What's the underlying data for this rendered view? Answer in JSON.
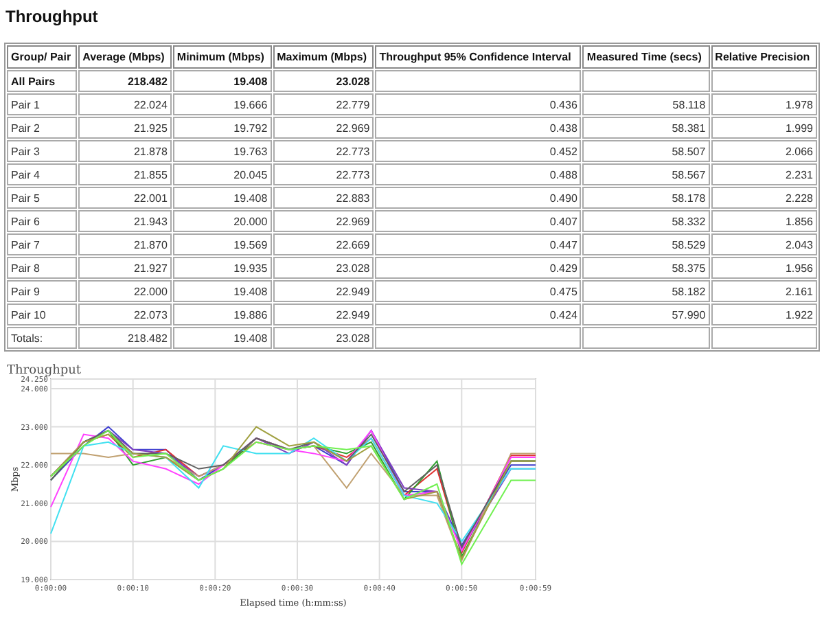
{
  "title": "Throughput",
  "table": {
    "columns": [
      "Group/ Pair",
      "Average (Mbps)",
      "Minimum (Mbps)",
      "Maximum (Mbps)",
      "Throughput 95% Confidence Interval",
      "Measured Time (secs)",
      "Relative Precision"
    ],
    "rows": [
      {
        "kind": "group",
        "cells": [
          "All Pairs",
          "218.482",
          "19.408",
          "23.028"
        ]
      },
      {
        "kind": "pair",
        "cells": [
          "Pair 1",
          "22.024",
          "19.666",
          "22.779",
          "0.436",
          "58.118",
          "1.978"
        ]
      },
      {
        "kind": "pair",
        "cells": [
          "Pair 2",
          "21.925",
          "19.792",
          "22.969",
          "0.438",
          "58.381",
          "1.999"
        ]
      },
      {
        "kind": "pair",
        "cells": [
          "Pair 3",
          "21.878",
          "19.763",
          "22.773",
          "0.452",
          "58.507",
          "2.066"
        ]
      },
      {
        "kind": "pair",
        "cells": [
          "Pair 4",
          "21.855",
          "20.045",
          "22.773",
          "0.488",
          "58.567",
          "2.231"
        ]
      },
      {
        "kind": "pair",
        "cells": [
          "Pair 5",
          "22.001",
          "19.408",
          "22.883",
          "0.490",
          "58.178",
          "2.228"
        ]
      },
      {
        "kind": "pair",
        "cells": [
          "Pair 6",
          "21.943",
          "20.000",
          "22.969",
          "0.407",
          "58.332",
          "1.856"
        ]
      },
      {
        "kind": "pair",
        "cells": [
          "Pair 7",
          "21.870",
          "19.569",
          "22.669",
          "0.447",
          "58.529",
          "2.043"
        ]
      },
      {
        "kind": "pair",
        "cells": [
          "Pair 8",
          "21.927",
          "19.935",
          "23.028",
          "0.429",
          "58.375",
          "1.956"
        ]
      },
      {
        "kind": "pair",
        "cells": [
          "Pair 9",
          "22.000",
          "19.408",
          "22.949",
          "0.475",
          "58.182",
          "2.161"
        ]
      },
      {
        "kind": "pair",
        "cells": [
          "Pair 10",
          "22.073",
          "19.886",
          "22.949",
          "0.424",
          "57.990",
          "1.922"
        ]
      },
      {
        "kind": "total",
        "cells": [
          "Totals:",
          "218.482",
          "19.408",
          "23.028"
        ]
      }
    ]
  },
  "chart": {
    "chart_data": {
      "type": "line",
      "grid": true,
      "title": "Throughput",
      "xlabel": "Elapsed time (h:mm:ss)",
      "ylabel": "Mbps",
      "x": [
        0,
        4,
        7,
        10,
        14,
        18,
        21,
        25,
        29,
        32,
        36,
        39,
        43,
        47,
        50,
        56,
        59
      ],
      "series": [
        {
          "color": "#4040d0",
          "values": [
            21.6,
            22.5,
            23.0,
            22.4,
            22.4,
            21.6,
            22.0,
            22.7,
            22.4,
            22.5,
            22.0,
            22.9,
            21.3,
            21.3,
            19.9,
            22.0,
            22.0
          ]
        },
        {
          "color": "#e03030",
          "values": [
            21.7,
            22.6,
            22.8,
            22.2,
            22.4,
            21.7,
            22.0,
            22.6,
            22.4,
            22.5,
            22.2,
            22.7,
            21.2,
            21.9,
            19.7,
            22.25,
            22.25
          ]
        },
        {
          "color": "#30a030",
          "values": [
            21.6,
            22.6,
            22.9,
            22.0,
            22.2,
            21.6,
            21.9,
            22.7,
            22.4,
            22.5,
            22.3,
            22.6,
            21.1,
            22.1,
            19.6,
            22.1,
            22.1
          ]
        },
        {
          "color": "#8040c0",
          "values": [
            21.7,
            22.6,
            22.9,
            22.4,
            22.3,
            21.7,
            22.0,
            22.7,
            22.3,
            22.6,
            22.0,
            22.9,
            21.4,
            21.3,
            19.8,
            21.9,
            21.9
          ]
        },
        {
          "color": "#c0a070",
          "values": [
            22.3,
            22.3,
            22.2,
            22.3,
            22.2,
            21.7,
            22.0,
            22.7,
            22.4,
            22.5,
            21.4,
            22.3,
            21.2,
            21.2,
            19.5,
            22.3,
            22.3
          ]
        },
        {
          "color": "#ff40ff",
          "values": [
            20.9,
            22.8,
            22.7,
            22.1,
            21.9,
            21.5,
            22.0,
            22.7,
            22.4,
            22.3,
            22.1,
            22.9,
            21.2,
            21.3,
            19.75,
            22.2,
            22.2
          ]
        },
        {
          "color": "#40e0f0",
          "values": [
            20.2,
            22.5,
            22.6,
            22.3,
            22.2,
            21.4,
            22.5,
            22.3,
            22.3,
            22.7,
            22.1,
            22.7,
            21.2,
            21.0,
            20.0,
            21.9,
            21.9
          ]
        },
        {
          "color": "#606060",
          "values": [
            21.6,
            22.6,
            22.9,
            22.3,
            22.3,
            21.9,
            22.0,
            22.7,
            22.4,
            22.6,
            22.1,
            22.8,
            21.3,
            22.0,
            19.85,
            22.1,
            22.1
          ]
        },
        {
          "color": "#a0a040",
          "values": [
            21.7,
            22.6,
            22.8,
            22.3,
            22.2,
            21.6,
            21.9,
            23.0,
            22.5,
            22.6,
            22.1,
            22.5,
            21.1,
            21.3,
            19.55,
            22.1,
            22.1
          ]
        },
        {
          "color": "#70f050",
          "values": [
            21.7,
            22.5,
            22.9,
            22.2,
            22.3,
            21.6,
            21.9,
            22.6,
            22.4,
            22.5,
            22.4,
            22.5,
            21.1,
            21.5,
            19.4,
            21.6,
            21.6
          ]
        }
      ],
      "xlim": [
        0,
        59
      ],
      "ylim": [
        19,
        24.25
      ],
      "xticks": [
        {
          "value": 0,
          "label": "0:00:00"
        },
        {
          "value": 10,
          "label": "0:00:10"
        },
        {
          "value": 20,
          "label": "0:00:20"
        },
        {
          "value": 30,
          "label": "0:00:30"
        },
        {
          "value": 40,
          "label": "0:00:40"
        },
        {
          "value": 50,
          "label": "0:00:50"
        },
        {
          "value": 59,
          "label": "0:00:59"
        }
      ],
      "yticks": [
        {
          "value": 19,
          "label": "19.000"
        },
        {
          "value": 20,
          "label": "20.000"
        },
        {
          "value": 21,
          "label": "21.000"
        },
        {
          "value": 22,
          "label": "22.000"
        },
        {
          "value": 23,
          "label": "23.000"
        },
        {
          "value": 24,
          "label": "24.000"
        },
        {
          "value": 24.25,
          "label": "24.250"
        }
      ]
    }
  }
}
